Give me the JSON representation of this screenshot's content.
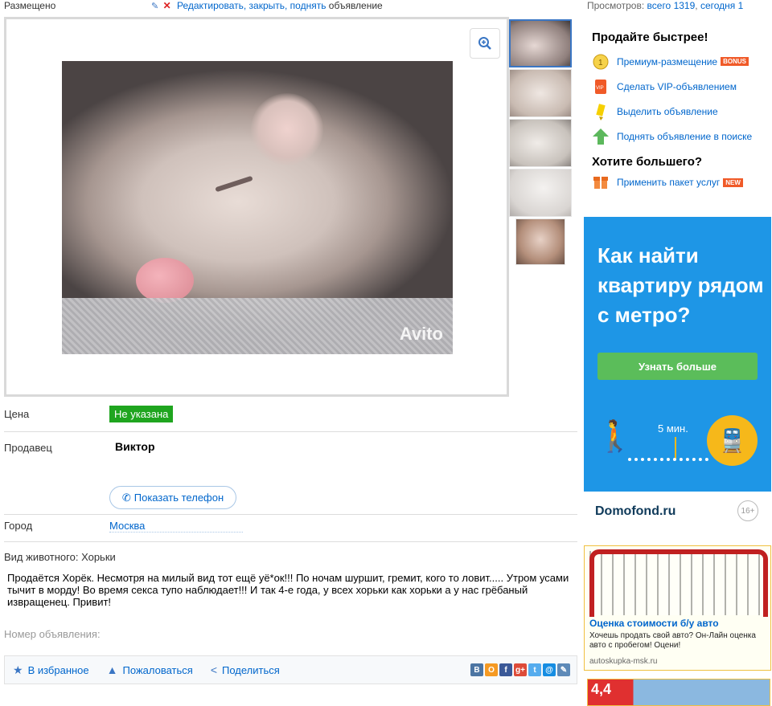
{
  "topbar": {
    "placed_label": "Размещено",
    "edit_prefix": "Редактировать, закрыть, поднять",
    "edit_suffix": "объявление",
    "views_label": "Просмотров:",
    "views_total": "всего 1319",
    "views_today": "сегодня 1"
  },
  "gallery": {
    "watermark": "Avito",
    "thumb_count": 5
  },
  "details": {
    "price_label": "Цена",
    "price_value": "Не указана",
    "seller_label": "Продавец",
    "seller_name": "Виктор",
    "phone_button": "Показать телефон",
    "city_label": "Город",
    "city_value": "Москва",
    "animal_type": "Вид животного: Хорьки",
    "description": "Продаётся Хорёк. Несмотря на милый вид тот ещё уё*ок!!! По ночам шуршит, гремит, кого то ловит..... Утром усами тычит в морду! Во время секса тупо наблюдает!!! И так 4-е года, у всех хорьки как хорьки а у нас грёбаный извращенец. Привит!",
    "ad_number_label": "Номер объявления:"
  },
  "actions": {
    "favorite": "В избранное",
    "complain": "Пожаловаться",
    "share": "Поделиться",
    "socials": [
      {
        "name": "vk",
        "label": "В",
        "color": "#4c75a3"
      },
      {
        "name": "odnoklassniki",
        "label": "O",
        "color": "#f59a23"
      },
      {
        "name": "facebook",
        "label": "f",
        "color": "#3b5998"
      },
      {
        "name": "google-plus",
        "label": "g+",
        "color": "#dd4b39"
      },
      {
        "name": "twitter",
        "label": "t",
        "color": "#55acee"
      },
      {
        "name": "mail",
        "label": "@",
        "color": "#168de2"
      },
      {
        "name": "livejournal",
        "label": "✎",
        "color": "#5e8ab8"
      }
    ]
  },
  "sell_faster": {
    "title": "Продайте быстрее!",
    "items": [
      {
        "label": "Премиум-размещение",
        "badge": "BONUS",
        "icon": "coin-icon"
      },
      {
        "label": "Сделать VIP-объявлением",
        "badge": "",
        "icon": "vip-icon"
      },
      {
        "label": "Выделить объявление",
        "badge": "",
        "icon": "marker-icon"
      },
      {
        "label": "Поднять объявление в поиске",
        "badge": "",
        "icon": "arrow-up-icon"
      }
    ],
    "more_title": "Хотите большего?",
    "package": {
      "label": "Применить пакет услуг",
      "badge": "NEW",
      "icon": "package-icon"
    }
  },
  "banner_domofond": {
    "headline": "Как найти квартиру рядом с метро?",
    "cta": "Узнать больше",
    "minutes": "5 мин.",
    "brand": "Domofond.ru",
    "age": "16+"
  },
  "banner_auto": {
    "title": "Оценка стоимости б/у авто",
    "text": "Хочешь продать свой авто? Он-Лайн оценка авто с пробегом! Оцени!",
    "domain": "autoskupka-msk.ru"
  },
  "banner_bottom": {
    "value": "4,4"
  },
  "colors": {
    "link": "#0066cc",
    "price_badge": "#1fa51f",
    "domofond_bg": "#1e96e6",
    "domofond_cta": "#5bbd5a",
    "metro_circle": "#f6b81a"
  }
}
